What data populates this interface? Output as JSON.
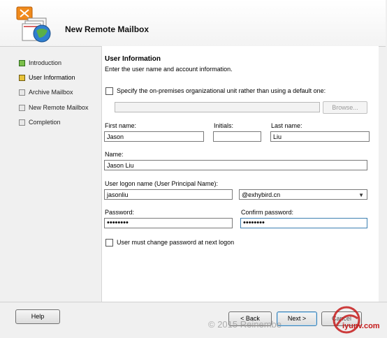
{
  "wizard": {
    "title": "New Remote Mailbox"
  },
  "nav": {
    "items": [
      {
        "label": "Introduction",
        "state": "done"
      },
      {
        "label": "User Information",
        "state": "current"
      },
      {
        "label": "Archive Mailbox",
        "state": "pending"
      },
      {
        "label": "New Remote Mailbox",
        "state": "pending"
      },
      {
        "label": "Completion",
        "state": "pending"
      }
    ]
  },
  "section": {
    "title": "User Information",
    "description": "Enter the user name and account information."
  },
  "form": {
    "ou_checkbox_label": "Specify the on-premises organizational unit rather than using a default one:",
    "ou_checked": false,
    "ou_value": "",
    "browse_label": "Browse...",
    "first_name_label": "First name:",
    "first_name": "Jason",
    "initials_label": "Initials:",
    "initials": "",
    "last_name_label": "Last name:",
    "last_name": "Liu",
    "name_label": "Name:",
    "name": "Jason Liu",
    "logon_label": "User logon name (User Principal Name):",
    "logon": "jasonliu",
    "domain": "@exhybird.cn",
    "password_label": "Password:",
    "password": "••••••••",
    "confirm_label": "Confirm password:",
    "confirm": "••••••••",
    "must_change_label": "User must change password at next logon",
    "must_change_checked": false
  },
  "buttons": {
    "help": "Help",
    "back": "< Back",
    "next": "Next >",
    "cancel": "Cancel"
  },
  "watermark": {
    "text": "© 2015 Reinembe",
    "site": "iyunv.com"
  },
  "colors": {
    "done": "#7bbf4a",
    "current": "#e8c33a",
    "focus": "#3c7fb1"
  }
}
